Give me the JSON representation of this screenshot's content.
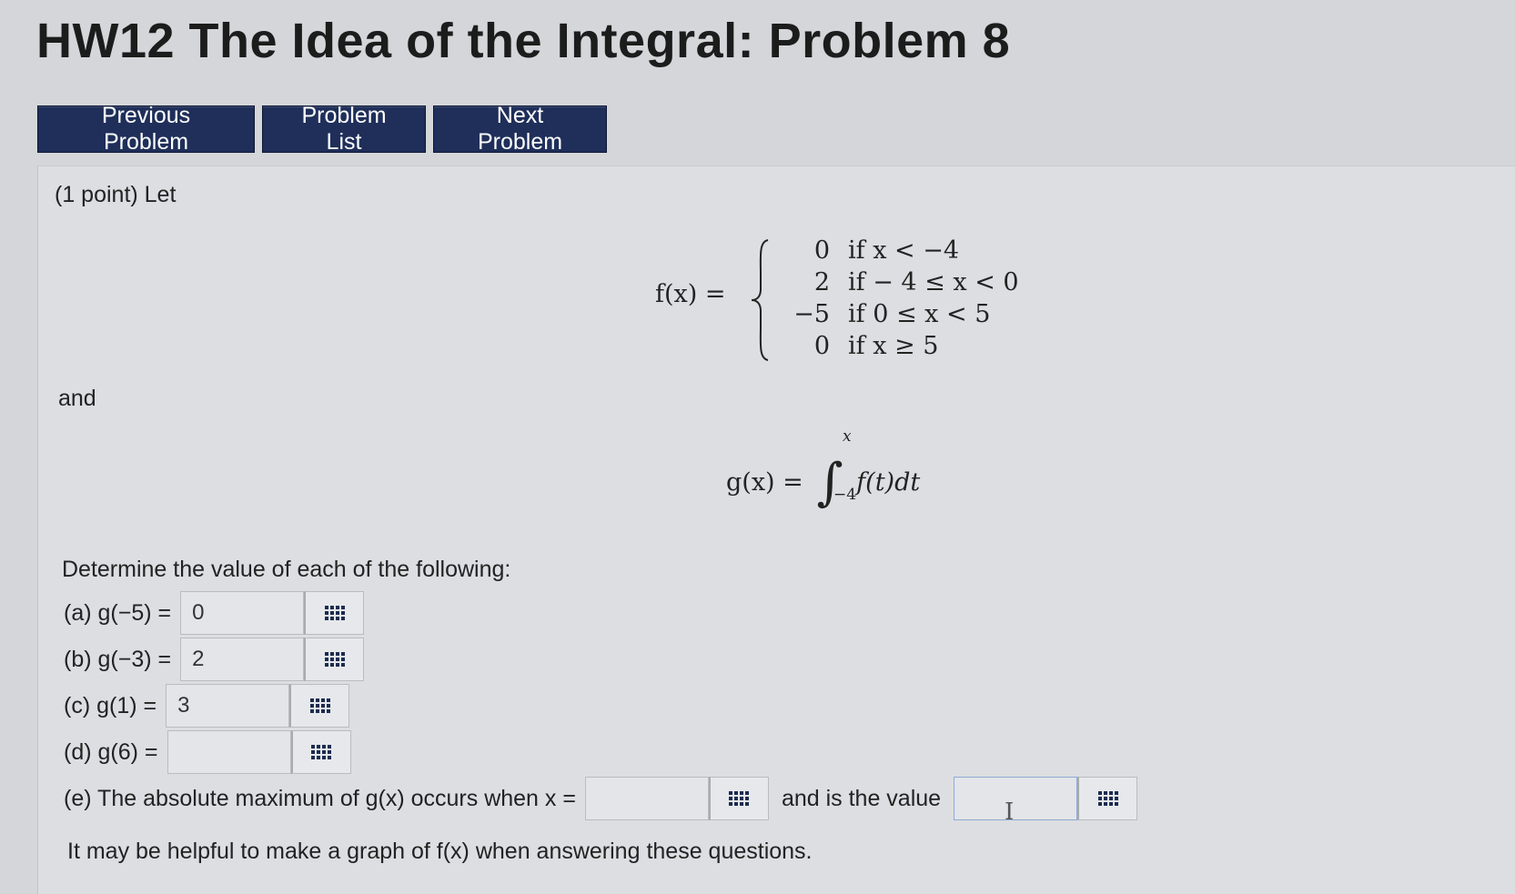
{
  "page": {
    "title": "HW12 The Idea of the Integral: Problem 8"
  },
  "nav": {
    "previous": "Previous Problem",
    "list": "Problem List",
    "next": "Next Problem"
  },
  "problem": {
    "intro": "(1 point) Let",
    "f_lhs": "f(x) =",
    "cases": [
      {
        "value": "0",
        "condition": "if x < −4"
      },
      {
        "value": "2",
        "condition": "if − 4 ≤ x < 0"
      },
      {
        "value": "−5",
        "condition": "if 0 ≤ x < 5"
      },
      {
        "value": "0",
        "condition": "if x ≥ 5"
      }
    ],
    "and": "and",
    "g_lhs": "g(x) =",
    "g_upper": "x",
    "g_lower": "−4",
    "g_integrand": "f(t)dt",
    "instructions": "Determine the value of each of the following:",
    "questions": [
      {
        "label": "(a) g(−5) =",
        "value": "0"
      },
      {
        "label": "(b) g(−3) =",
        "value": "2"
      },
      {
        "label": "(c) g(1) =",
        "value": "3"
      },
      {
        "label": "(d) g(6) =",
        "value": ""
      }
    ],
    "part_e": {
      "label": "(e) The absolute maximum of g(x) occurs when x =",
      "x_value": "",
      "middle": "and is the value",
      "max_value": ""
    },
    "hint": "It may be helpful to make a graph of f(x) when answering these questions."
  },
  "icons": {
    "answer_tool": "grid-icon",
    "text_cursor": "text-cursor-icon"
  },
  "colors": {
    "nav_button": "#1f2f5a",
    "background": "#d4d6d9"
  }
}
